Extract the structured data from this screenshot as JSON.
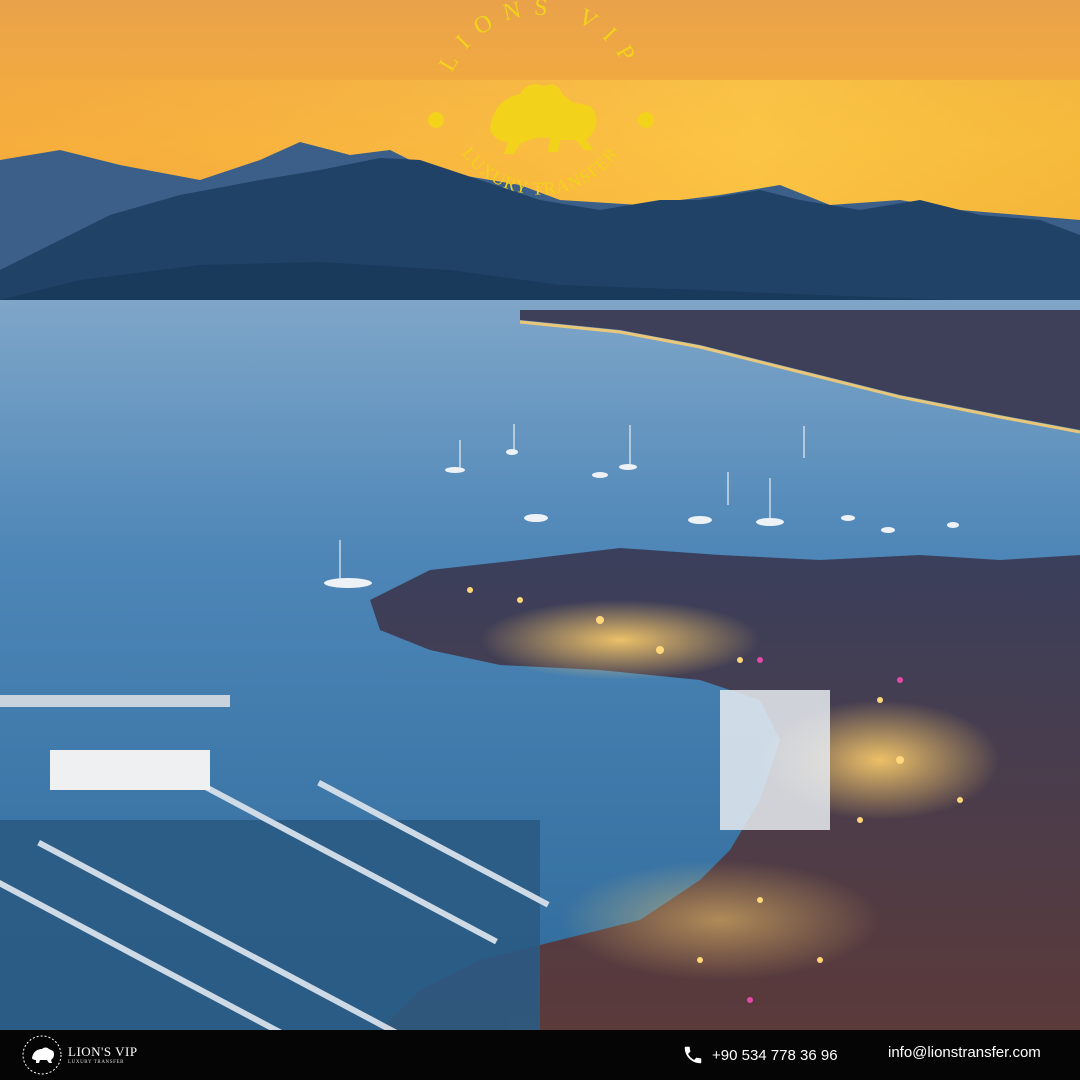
{
  "brand": {
    "seal_top_text": "LIONS VIP",
    "seal_bottom_text": "LUXURY TRANSFER",
    "footer_name": "LION'S VIP",
    "footer_sub": "LUXURY TRANSFER",
    "gold_color": "#f2d21b"
  },
  "contact": {
    "phone": "+90 534 778 36 96",
    "email": "info@lionstransfer.com",
    "phone_icon": "phone-icon"
  },
  "scene": {
    "subject": "sunset-harbor-photo",
    "sky_colors": [
      "#f9b33a",
      "#f7c04a",
      "#f29a35"
    ],
    "sea_color": "#3f7fb3"
  }
}
